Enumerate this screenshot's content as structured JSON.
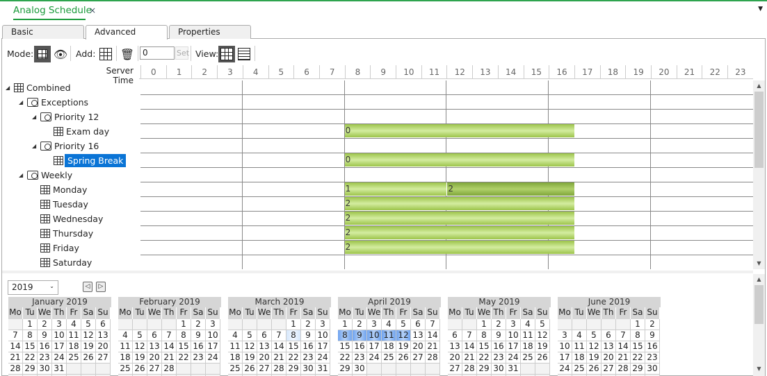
{
  "window": {
    "doc_tab": "Analog Schedule",
    "close": "×"
  },
  "tabs": [
    {
      "label": "Basic",
      "active": false
    },
    {
      "label": "Advanced",
      "active": true
    },
    {
      "label": "Properties",
      "active": false
    }
  ],
  "toolbar": {
    "mode_label": "Mode:",
    "add_label": "Add:",
    "view_label": "View:",
    "value_input": "0",
    "set_label": "Set"
  },
  "grid": {
    "server_time_label": "Server Time",
    "hours": [
      "0",
      "1",
      "2",
      "3",
      "4",
      "5",
      "6",
      "7",
      "8",
      "9",
      "10",
      "11",
      "12",
      "13",
      "14",
      "15",
      "16",
      "17",
      "18",
      "19",
      "20",
      "21",
      "22",
      "23"
    ]
  },
  "tree": [
    {
      "label": "Combined",
      "level": 0,
      "icon": "schedule-icon",
      "expand": true
    },
    {
      "label": "Exceptions",
      "level": 1,
      "icon": "folder-schedule-icon",
      "expand": true
    },
    {
      "label": "Priority 12",
      "level": 2,
      "icon": "folder-schedule-icon",
      "expand": true
    },
    {
      "label": "Exam day",
      "level": 3,
      "icon": "schedule-icon",
      "expand": false
    },
    {
      "label": "Priority 16",
      "level": 2,
      "icon": "folder-schedule-icon",
      "expand": true
    },
    {
      "label": "Spring Break",
      "level": 3,
      "icon": "schedule-icon",
      "expand": false,
      "selected": true
    },
    {
      "label": "Weekly",
      "level": 1,
      "icon": "folder-schedule-icon",
      "expand": true
    },
    {
      "label": "Monday",
      "level": 2,
      "icon": "schedule-icon",
      "expand": false
    },
    {
      "label": "Tuesday",
      "level": 2,
      "icon": "schedule-icon",
      "expand": false
    },
    {
      "label": "Wednesday",
      "level": 2,
      "icon": "schedule-icon",
      "expand": false
    },
    {
      "label": "Thursday",
      "level": 2,
      "icon": "schedule-icon",
      "expand": false
    },
    {
      "label": "Friday",
      "level": 2,
      "icon": "schedule-icon",
      "expand": false
    },
    {
      "label": "Saturday",
      "level": 2,
      "icon": "schedule-icon",
      "expand": false
    }
  ],
  "bars": [
    {
      "row": 3,
      "start": 8,
      "end": 17,
      "value": "0"
    },
    {
      "row": 5,
      "start": 8,
      "end": 17,
      "value": "0"
    },
    {
      "row": 7,
      "start": 8,
      "end": 12,
      "value": "1"
    },
    {
      "row": 7,
      "start": 12,
      "end": 17,
      "value": "2",
      "dark": true
    },
    {
      "row": 8,
      "start": 8,
      "end": 17,
      "value": "2"
    },
    {
      "row": 9,
      "start": 8,
      "end": 17,
      "value": "2"
    },
    {
      "row": 10,
      "start": 8,
      "end": 17,
      "value": "2"
    },
    {
      "row": 11,
      "start": 8,
      "end": 17,
      "value": "2"
    }
  ],
  "calendar": {
    "year": "2019",
    "weekdays": [
      "Mo",
      "Tu",
      "We",
      "Th",
      "Fr",
      "Sa",
      "Su"
    ],
    "months": [
      {
        "title": "January 2019",
        "offset": 1,
        "days": 31
      },
      {
        "title": "February 2019",
        "offset": 4,
        "days": 28
      },
      {
        "title": "March 2019",
        "offset": 4,
        "days": 31,
        "light": [
          8
        ]
      },
      {
        "title": "April 2019",
        "offset": 0,
        "days": 30,
        "highlight": [
          8,
          9,
          10,
          11,
          12
        ]
      },
      {
        "title": "May 2019",
        "offset": 2,
        "days": 31
      },
      {
        "title": "June 2019",
        "offset": 5,
        "days": 30
      }
    ]
  },
  "colors": {
    "accent": "#1a9a3a",
    "bar": "#a8cd5c",
    "bar_dark": "#8fb548",
    "selection": "#0a74d6",
    "highlight": "#6fa3ef"
  }
}
